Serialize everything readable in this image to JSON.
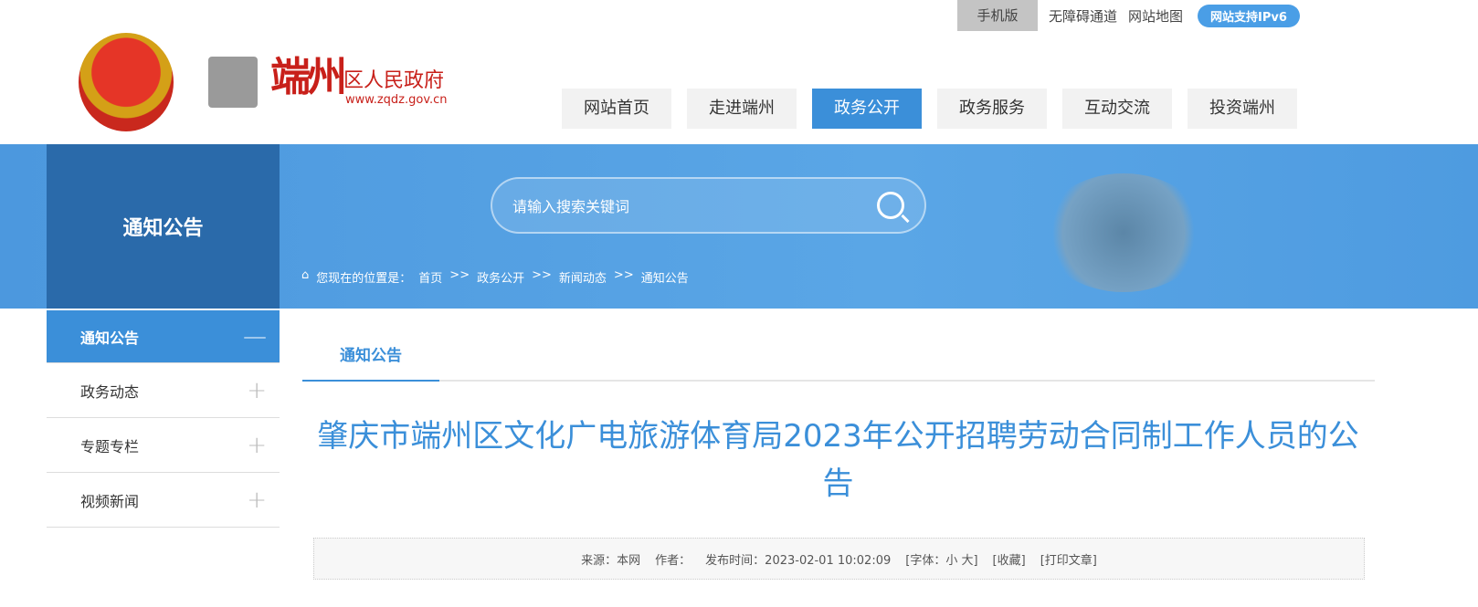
{
  "topbar": {
    "mobile": "手机版",
    "accessibility": "无障碍通道",
    "sitemap": "网站地图",
    "ipv6": "网站支持IPv6"
  },
  "logo": {
    "brush": "端州",
    "name": "区人民政府",
    "url": "www.zqdz.gov.cn"
  },
  "nav": [
    "网站首页",
    "走进端州",
    "政务公开",
    "政务服务",
    "互动交流",
    "投资端州"
  ],
  "nav_active": 2,
  "section_title": "通知公告",
  "search": {
    "placeholder": "请输入搜索关键词"
  },
  "breadcrumb": {
    "label": "您现在的位置是：",
    "items": [
      "首页",
      "政务公开",
      "新闻动态",
      "通知公告"
    ],
    "sep": ">>"
  },
  "sidebar": [
    {
      "label": "通知公告",
      "sign": "—"
    },
    {
      "label": "政务动态",
      "sign": "+"
    },
    {
      "label": "专题专栏",
      "sign": "+"
    },
    {
      "label": "视频新闻",
      "sign": "+"
    }
  ],
  "tab": "通知公告",
  "article": {
    "title": "肇庆市端州区文化广电旅游体育局2023年公开招聘劳动合同制工作人员的公告",
    "source": "来源：本网",
    "author": "作者：",
    "published": "发布时间：2023-02-01 10:02:09",
    "font": "[字体：小 大]",
    "favorite": "[收藏]",
    "print": "[打印文章]"
  },
  "colors": {
    "accent": "#3b8fd9",
    "sidebar_dark": "#2a6aaa",
    "brand_red": "#c8201a"
  }
}
